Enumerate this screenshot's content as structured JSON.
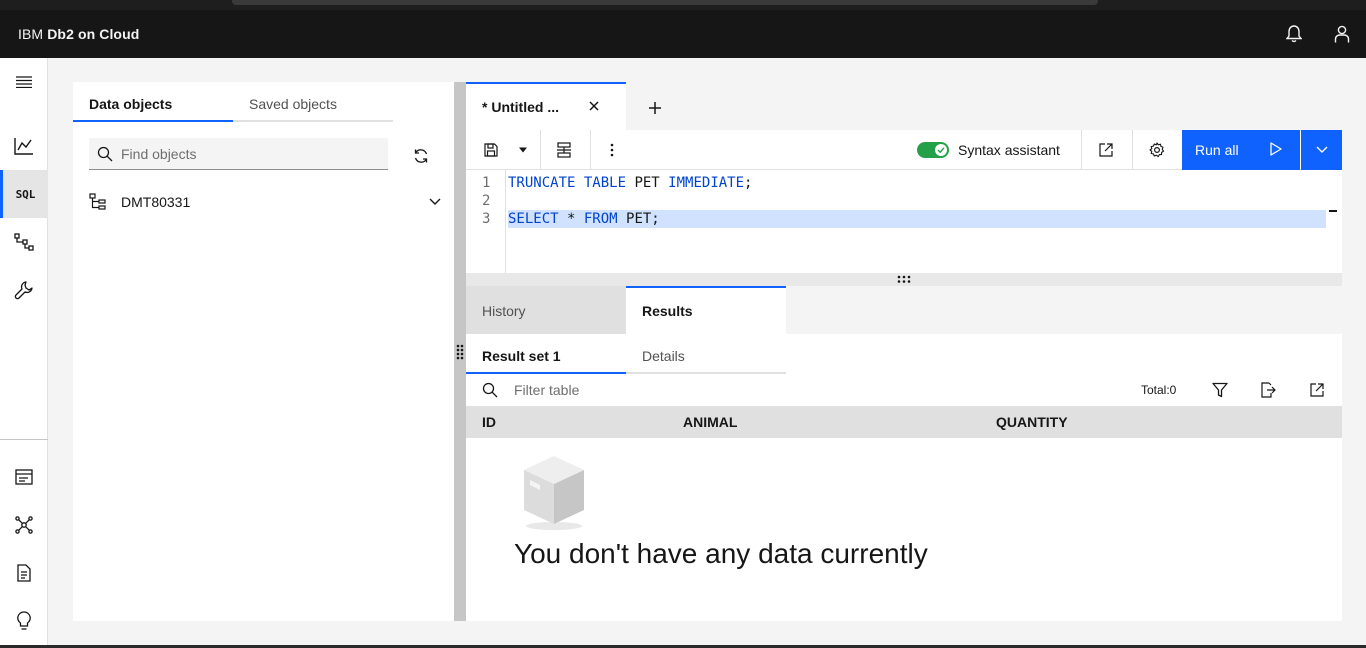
{
  "app": {
    "brand_prefix": "IBM",
    "brand_name": "Db2 on Cloud"
  },
  "left_panel": {
    "tabs": [
      {
        "label": "Data objects",
        "active": true
      },
      {
        "label": "Saved objects",
        "active": false
      }
    ],
    "search_placeholder": "Find objects",
    "schemas": [
      {
        "label": "DMT80331"
      }
    ]
  },
  "editor": {
    "tab": {
      "label": "* Untitled ..."
    },
    "toolbar": {
      "syntax_assistant_label": "Syntax assistant",
      "syntax_assistant_on": true,
      "run_label": "Run all"
    },
    "lines": [
      {
        "num": "1",
        "tokens": [
          {
            "text": "TRUNCATE TABLE",
            "kw": true
          },
          {
            "text": " PET ",
            "kw": false
          },
          {
            "text": "IMMEDIATE",
            "kw": true
          },
          {
            "text": ";",
            "kw": false
          }
        ]
      },
      {
        "num": "2",
        "tokens": []
      },
      {
        "num": "3",
        "tokens": [
          {
            "text": "SELECT",
            "kw": true
          },
          {
            "text": " * ",
            "kw": false
          },
          {
            "text": "FROM",
            "kw": true
          },
          {
            "text": " PET;",
            "kw": false
          }
        ],
        "highlighted": true
      }
    ]
  },
  "results": {
    "tabs": [
      {
        "label": "History",
        "active": false
      },
      {
        "label": "Results",
        "active": true
      }
    ],
    "sub_tabs": [
      {
        "label": "Result set 1",
        "active": true
      },
      {
        "label": "Details",
        "active": false
      }
    ],
    "filter_placeholder": "Filter table",
    "total_label": "Total:0",
    "columns": [
      "ID",
      "ANIMAL",
      "QUANTITY"
    ],
    "empty_message": "You don't have any data currently"
  },
  "colors": {
    "accent": "#0f62fe",
    "header_bg": "#161616",
    "toggle_on": "#24a148",
    "line_highlight": "#d0e2ff",
    "keyword": "#0043ce"
  }
}
